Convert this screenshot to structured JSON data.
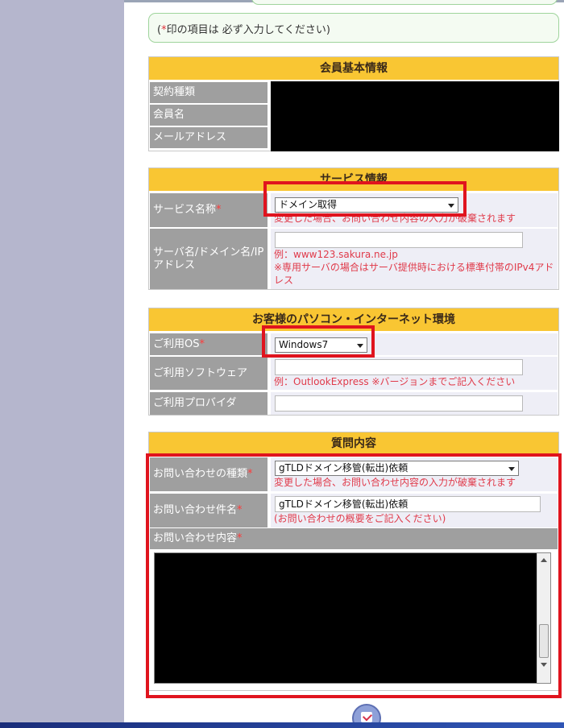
{
  "notice": {
    "open": "(",
    "star": "*",
    "text": "印の項目は 必ず入力してください)"
  },
  "member": {
    "heading": "会員基本情報",
    "rows": [
      {
        "label": "契約種類"
      },
      {
        "label": "会員名"
      },
      {
        "label": "メールアドレス"
      }
    ]
  },
  "service": {
    "heading": "サービス情報",
    "name_label": "サービス名称",
    "star": "*",
    "name_value": "ドメイン取得",
    "name_hint": "変更した場合、お問い合わせ内容の入力が破棄されます",
    "server_label": "サーバ名/ドメイン名/IPアドレス",
    "server_hint1": "例：www123.sakura.ne.jp",
    "server_hint2": "※専用サーバの場合はサーバ提供時における標準付帯のIPv4アドレス"
  },
  "env": {
    "heading": "お客様のパソコン・インターネット環境",
    "os_label": "ご利用OS",
    "star": "*",
    "os_value": "Windows7",
    "software_label": "ご利用ソフトウェア",
    "software_hint": "例：OutlookExpress ※バージョンまでご記入ください",
    "provider_label": "ご利用プロバイダ"
  },
  "inquiry": {
    "heading": "質問内容",
    "type_label": "お問い合わせの種類",
    "star": "*",
    "type_value": "gTLDドメイン移管(転出)依頼",
    "type_hint": "変更した場合、お問い合わせ内容の入力が破棄されます",
    "subject_label": "お問い合わせ件名",
    "subject_value": "gTLDドメイン移管(転出)依頼",
    "subject_hint": "(お問い合わせの概要をご記入ください)",
    "content_label": "お問い合わせ内容"
  },
  "colors": {
    "section_header": "#f9c633",
    "label_bg": "#9f9f9f",
    "highlight": "#e0141e",
    "hint": "#e03a4a"
  },
  "icons": {
    "submit": "confirm-icon"
  }
}
